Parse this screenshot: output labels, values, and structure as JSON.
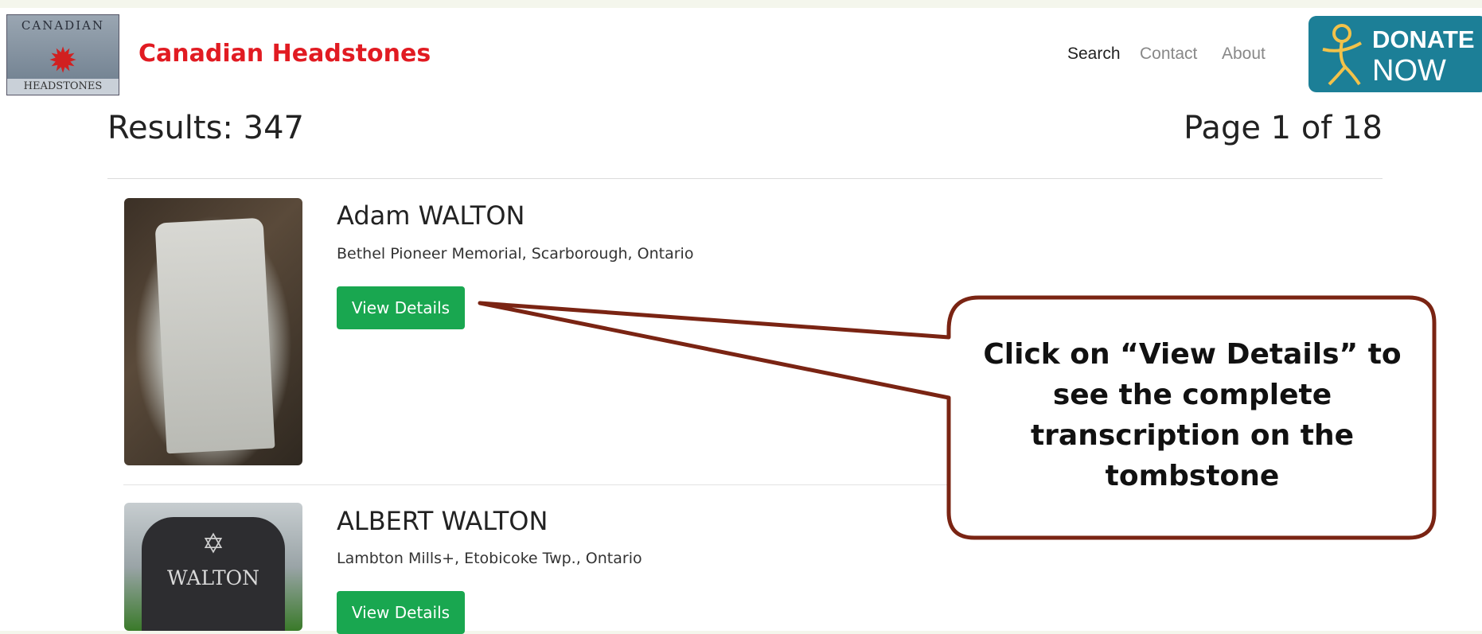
{
  "site": {
    "logo_text_top": "CANADIAN",
    "logo_text_bottom": "HEADSTONES",
    "title": "Canadian Headstones"
  },
  "nav": {
    "search": "Search",
    "contact": "Contact",
    "about": "About"
  },
  "donate": {
    "line1": "DONATE",
    "line2": "NOW"
  },
  "summary": {
    "results": "Results: 347",
    "page": "Page 1 of 18"
  },
  "results": [
    {
      "name": "Adam WALTON",
      "location": "Bethel Pioneer Memorial, Scarborough, Ontario",
      "button": "View Details"
    },
    {
      "name": "ALBERT WALTON",
      "location": "Lambton Mills+, Etobicoke Twp., Ontario",
      "button": "View Details",
      "thumb_text": "WALTON"
    }
  ],
  "callout": {
    "line1": "Click on “View Details” to",
    "line2": "see the complete",
    "line3": "transcription on the",
    "line4": "tombstone"
  },
  "colors": {
    "brand_red": "#e11b22",
    "button_green": "#19a750",
    "callout_border": "#7a2413",
    "donate_teal": "#1c7f97"
  }
}
